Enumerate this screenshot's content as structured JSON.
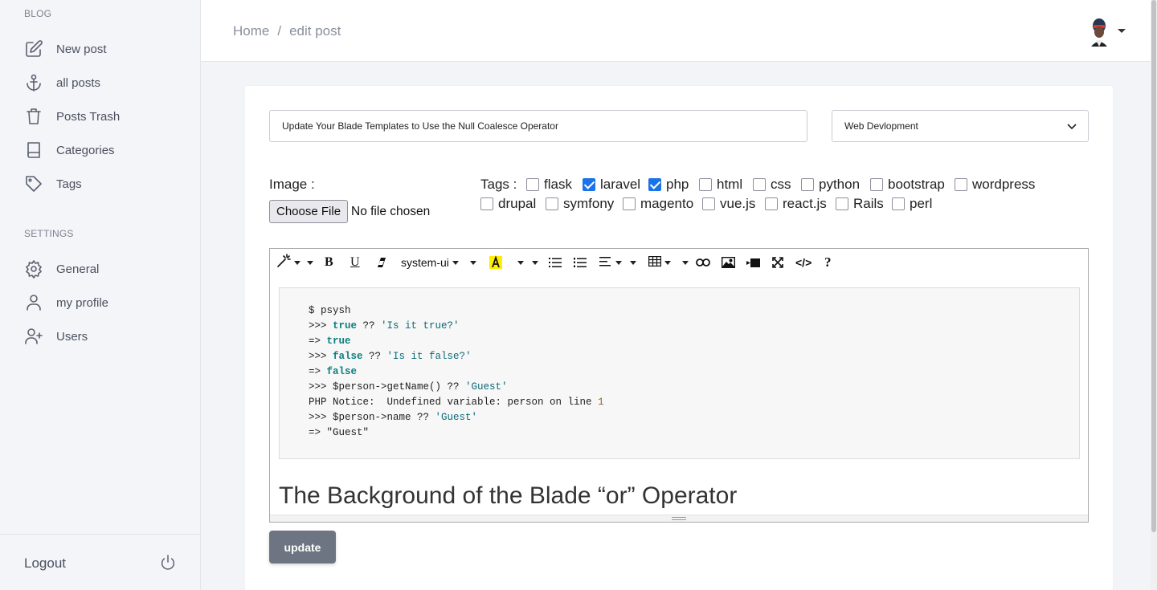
{
  "sidebar": {
    "blog_title": "BLOG",
    "blog_items": [
      {
        "label": "New post",
        "icon": "edit-icon"
      },
      {
        "label": "all posts",
        "icon": "anchor-icon"
      },
      {
        "label": "Posts Trash",
        "icon": "trash-icon"
      },
      {
        "label": "Categories",
        "icon": "book-icon"
      },
      {
        "label": "Tags",
        "icon": "tag-icon"
      }
    ],
    "settings_title": "SETTINGS",
    "settings_items": [
      {
        "label": "General",
        "icon": "gear-icon"
      },
      {
        "label": "my profile",
        "icon": "user-icon"
      },
      {
        "label": "Users",
        "icon": "user-plus-icon"
      }
    ],
    "logout_label": "Logout"
  },
  "header": {
    "breadcrumb": {
      "home": "Home",
      "separator": "/",
      "current": "edit post"
    }
  },
  "form": {
    "title_value": "Update Your Blade Templates to Use the Null Coalesce Operator",
    "category_value": "Web Devlopment",
    "image_label": "Image :",
    "file_button": "Choose File",
    "file_status": "No file chosen",
    "tags_label": "Tags :",
    "tags": [
      {
        "label": "flask",
        "checked": false
      },
      {
        "label": "laravel",
        "checked": true
      },
      {
        "label": "php",
        "checked": true
      },
      {
        "label": "html",
        "checked": false
      },
      {
        "label": "css",
        "checked": false
      },
      {
        "label": "python",
        "checked": false
      },
      {
        "label": "bootstrap",
        "checked": false
      },
      {
        "label": "wordpress",
        "checked": false
      },
      {
        "label": "drupal",
        "checked": false
      },
      {
        "label": "symfony",
        "checked": false
      },
      {
        "label": "magento",
        "checked": false
      },
      {
        "label": "vue.js",
        "checked": false
      },
      {
        "label": "react.js",
        "checked": false
      },
      {
        "label": "Rails",
        "checked": false
      },
      {
        "label": "perl",
        "checked": false
      }
    ],
    "submit_label": "update"
  },
  "editor": {
    "font_name": "system-ui",
    "code_lines": [
      "$ psysh",
      ">>> true ?? 'Is it true?'",
      "=> true",
      ">>> false ?? 'Is it false?'",
      "=> false",
      ">>> $person->getName() ?? 'Guest'",
      "PHP Notice:  Undefined variable: person on line 1",
      ">>> $person->name ?? 'Guest'",
      "=> \"Guest\""
    ],
    "heading": "The Background of the Blade “or” Operator"
  },
  "colors": {
    "accent": "#1a73e8",
    "button": "#6e7582",
    "sidebar_bg": "#f4f5f8"
  }
}
